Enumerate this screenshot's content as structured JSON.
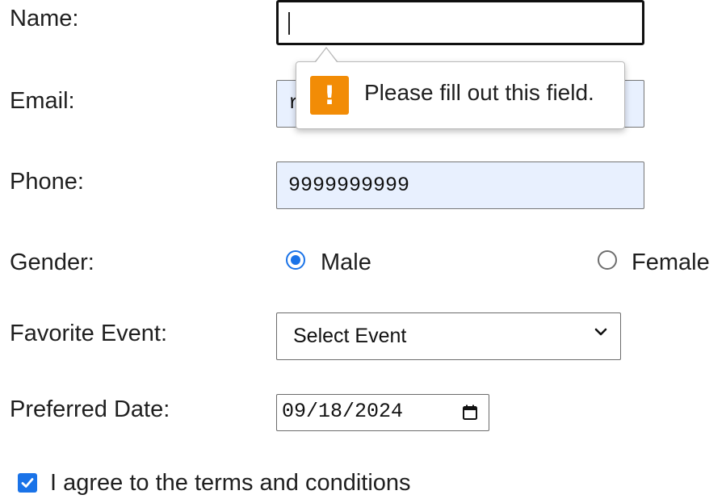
{
  "form": {
    "name": {
      "label": "Name:",
      "value": ""
    },
    "email": {
      "label": "Email:",
      "value_visible": "r"
    },
    "phone": {
      "label": "Phone:",
      "value": "9999999999"
    },
    "gender": {
      "label": "Gender:",
      "options": [
        {
          "label": "Male",
          "checked": true
        },
        {
          "label": "Female",
          "checked": false
        }
      ]
    },
    "favorite_event": {
      "label": "Favorite Event:",
      "selected": "Select Event"
    },
    "preferred_date": {
      "label": "Preferred Date:",
      "value": "09/18/2024"
    },
    "terms": {
      "label": "I agree to the terms and conditions",
      "checked": true
    }
  },
  "validation_tooltip": {
    "icon": "warning-icon",
    "icon_glyph": "!",
    "message": "Please fill out this field."
  },
  "colors": {
    "accent": "#1a73e8",
    "autofill_bg": "#e8f0fe",
    "warning": "#f28c06"
  }
}
